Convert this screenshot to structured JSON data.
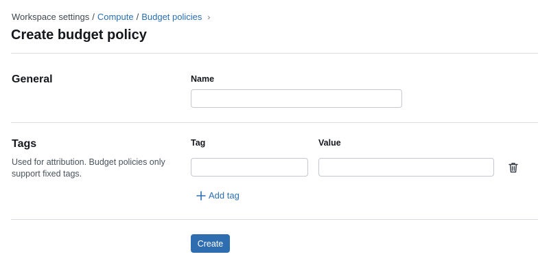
{
  "breadcrumb": {
    "items": [
      "Workspace settings",
      "Compute",
      "Budget policies"
    ],
    "separator": "/",
    "chevron": "›"
  },
  "page": {
    "title": "Create budget policy"
  },
  "general": {
    "title": "General",
    "name_label": "Name",
    "name_value": "",
    "name_placeholder": ""
  },
  "tags": {
    "title": "Tags",
    "description": "Used for attribution. Budget policies only support fixed tags.",
    "tag_label": "Tag",
    "value_label": "Value",
    "rows": [
      {
        "tag": "",
        "value": ""
      }
    ],
    "add_label": "Add tag",
    "delete_icon": "trash-icon",
    "add_icon": "plus-icon"
  },
  "actions": {
    "create_label": "Create"
  },
  "colors": {
    "accent": "#2e6db0",
    "link": "#2a6fb3",
    "divider": "#d8dbe0"
  }
}
